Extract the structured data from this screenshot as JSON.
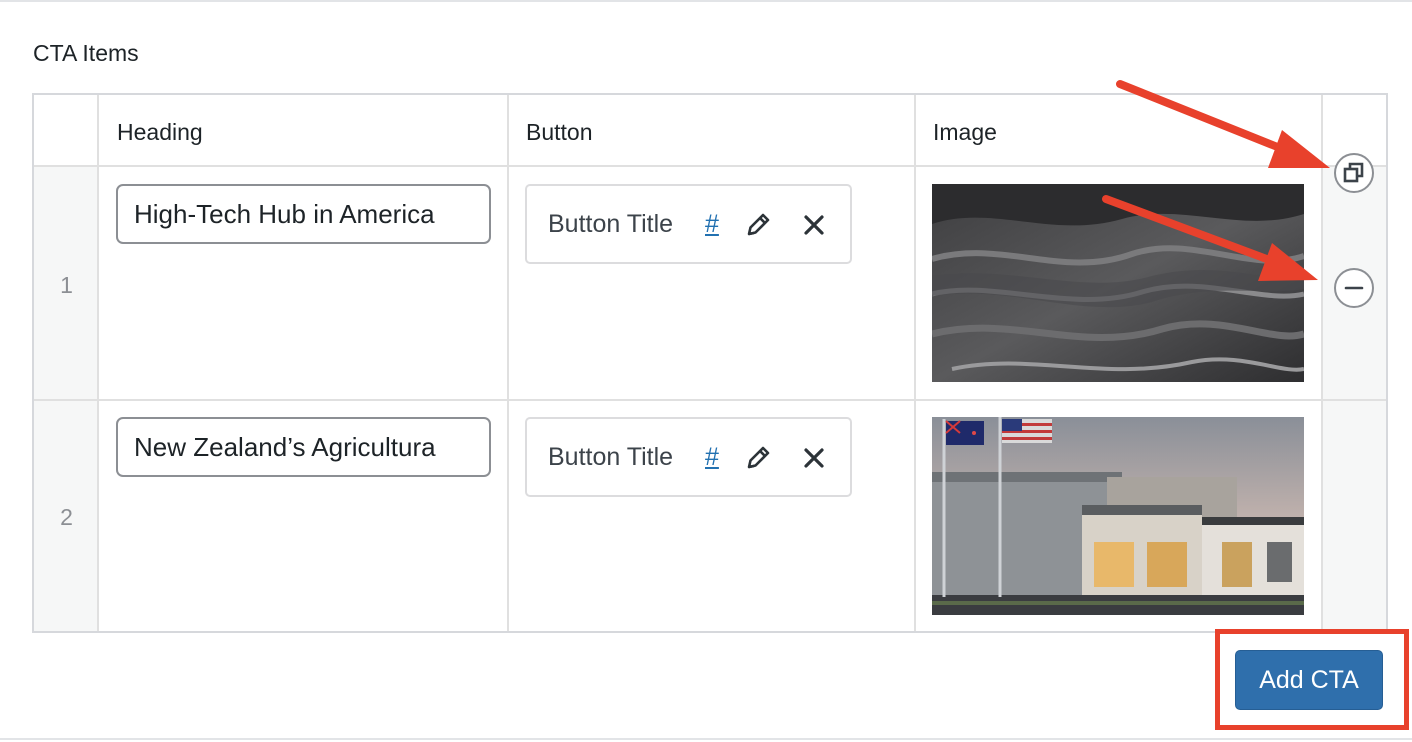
{
  "field": {
    "label": "CTA Items"
  },
  "columns": {
    "heading": "Heading",
    "button": "Button",
    "image": "Image"
  },
  "rows": [
    {
      "order": "1",
      "heading_value": "High-Tech Hub in America",
      "button": {
        "title": "Button Title",
        "url": "#"
      },
      "image": "image-black-sand-dunes"
    },
    {
      "order": "2",
      "heading_value": "New Zealand’s Agricultura",
      "button": {
        "title": "Button Title",
        "url": "#"
      },
      "image": "image-prolant-building-with-flags"
    }
  ],
  "actions": {
    "add_label": "Add CTA"
  },
  "icons": {
    "duplicate": "duplicate-icon",
    "remove_row": "minus-circle-icon",
    "edit": "pencil-icon",
    "remove_link": "close-icon"
  },
  "colors": {
    "primary_button": "#2f6fac",
    "annotation": "#e8412c",
    "link": "#2271b1"
  }
}
